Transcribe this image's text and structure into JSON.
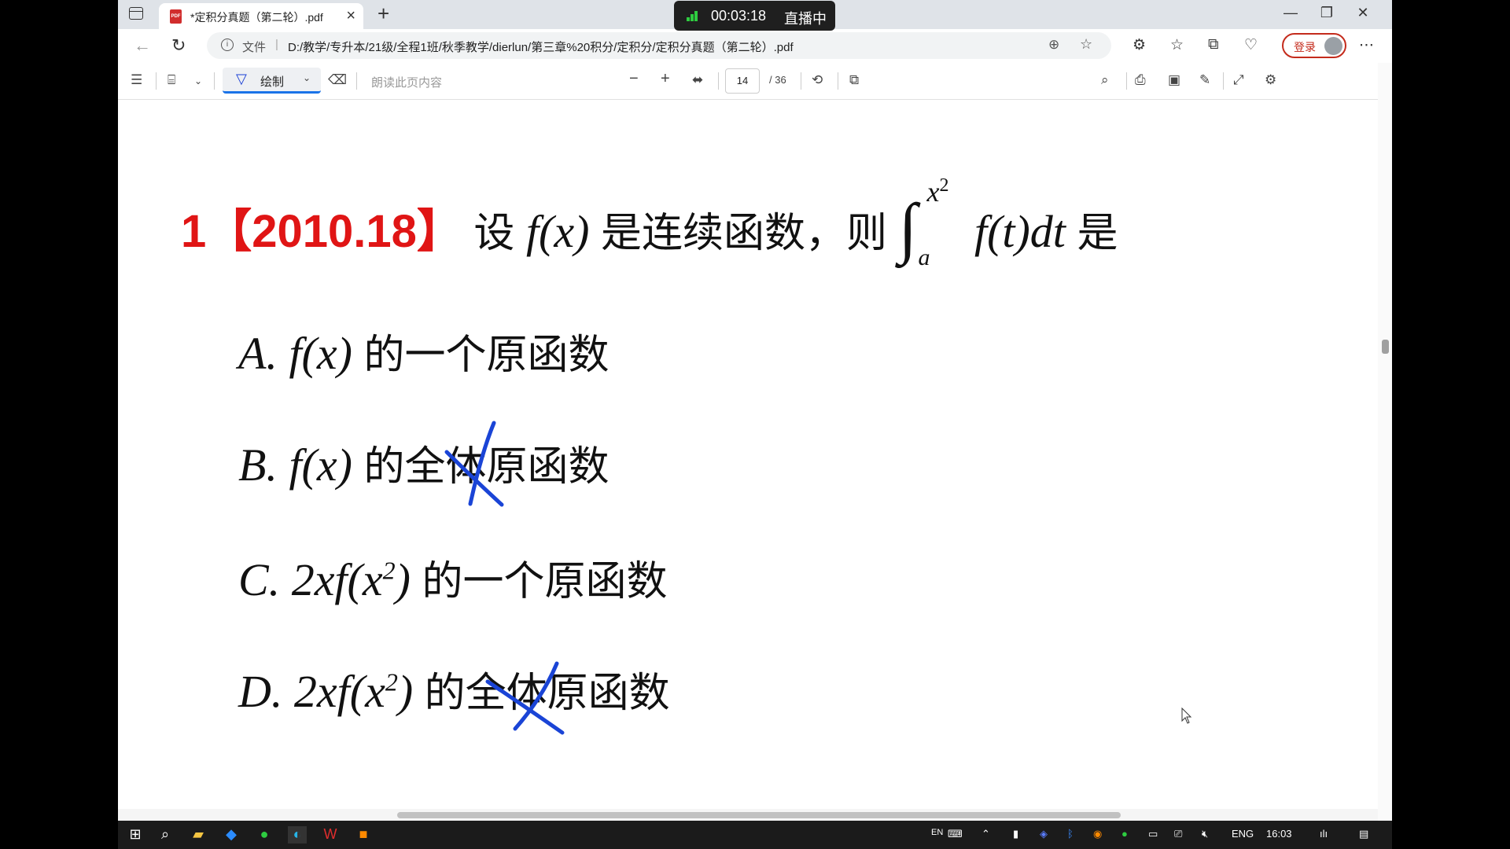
{
  "browser": {
    "tab_title": "*定积分真题（第二轮）.pdf",
    "pdf_icon_text": "PDF",
    "url_protocol": "文件",
    "url": "D:/教学/专升本/21级/全程1班/秋季教学/dierlun/第三章%20积分/定积分/定积分真题（第二轮）.pdf",
    "login_label": "登录"
  },
  "live": {
    "timer": "00:03:18",
    "status": "直播中"
  },
  "pdf_toolbar": {
    "draw_label": "绘制",
    "read_aloud": "朗读此页内容",
    "page_current": "14",
    "page_total": "/ 36"
  },
  "question": {
    "number": "1【2010.18】",
    "text_pre": "设",
    "fx": "f(x)",
    "text_mid": "是连续函数，则",
    "upper": "x",
    "upper_exp": "2",
    "lower": "a",
    "integrand": "f(t)dt",
    "text_post": "是"
  },
  "options": [
    {
      "label": "A.",
      "expr": "f(x)",
      "sup": "",
      "expr_tail": "",
      "text": "的一个原函数",
      "crossed": false
    },
    {
      "label": "B.",
      "expr": "f(x)",
      "sup": "",
      "expr_tail": "",
      "text": "的全体原函数",
      "crossed": true
    },
    {
      "label": "C.",
      "expr": "2xf(x",
      "sup": "2",
      "expr_tail": ")",
      "text": "的一个原函数",
      "crossed": false
    },
    {
      "label": "D.",
      "expr": "2xf(x",
      "sup": "2",
      "expr_tail": ")",
      "text": "的全体原函数",
      "crossed": true
    }
  ],
  "colors": {
    "accent_red": "#e01515",
    "annotation_blue": "#1a44d6",
    "browser_accent": "#1a73e8"
  },
  "taskbar": {
    "lang_en": "EN",
    "lang": "ENG",
    "time": "16:03"
  }
}
